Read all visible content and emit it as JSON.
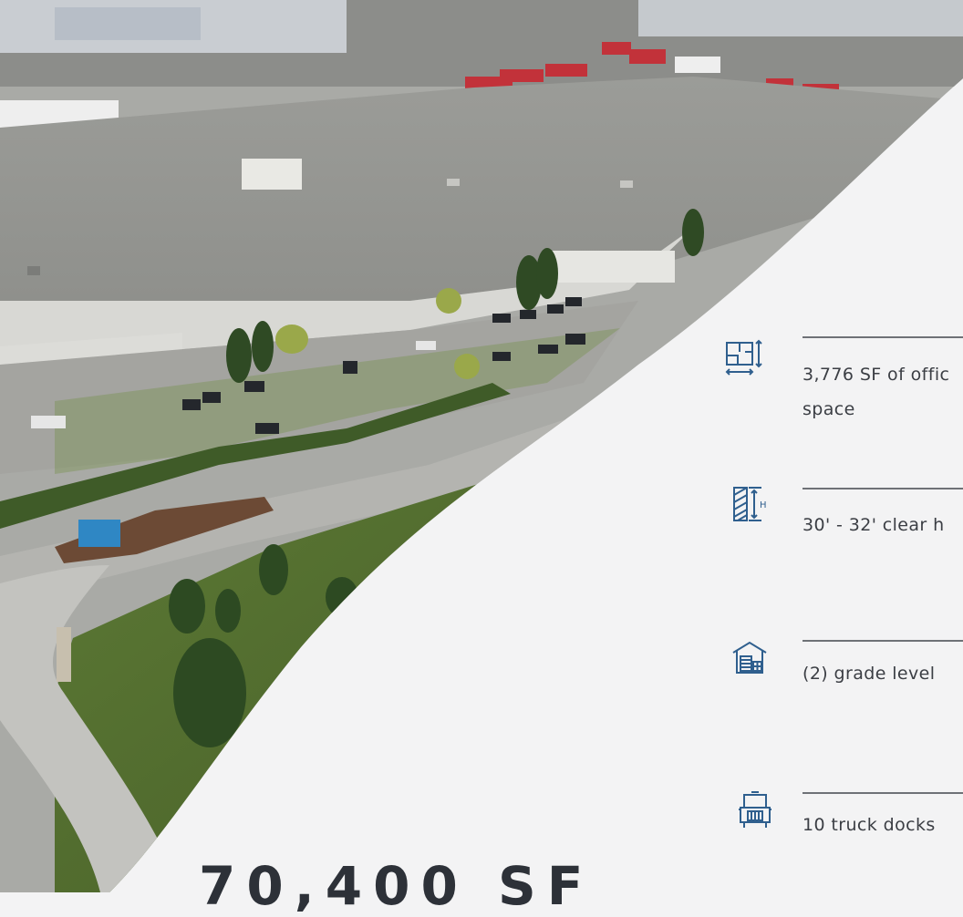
{
  "features": [
    {
      "icon": "floor-plan-icon",
      "text_line1": "3,776 SF of offic",
      "text_line2": "space"
    },
    {
      "icon": "clear-height-icon",
      "text_line1": "30' - 32' clear h",
      "text_line2": ""
    },
    {
      "icon": "warehouse-icon",
      "text_line1": "(2) grade level",
      "text_line2": ""
    },
    {
      "icon": "truck-icon",
      "text_line1": "10 truck docks",
      "text_line2": ""
    }
  ],
  "headline": "70,400 SF",
  "colors": {
    "background": "#f3f3f4",
    "icon_blue": "#2f5f8e",
    "rule": "#6e7176",
    "text": "#3b3e44"
  }
}
